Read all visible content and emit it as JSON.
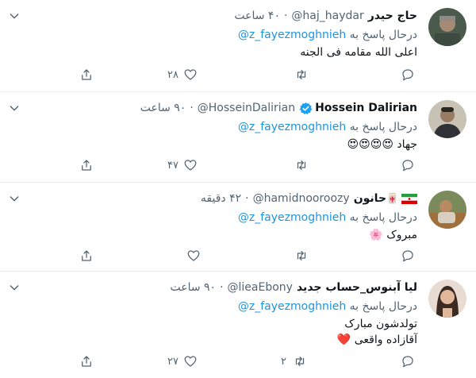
{
  "reply_prefix": "درحال پاسخ به",
  "colors": {
    "link": "#1b95e0",
    "muted": "#536471",
    "border": "#e6ecf0",
    "verified": "#1da1f2"
  },
  "tweets": [
    {
      "name": "حاج حیدر",
      "handle": "@haj_haydar",
      "time": "۴۰ ساعت",
      "reply_to": "@z_fayezmoghnieh",
      "text": "اعلی الله مقامه فی الجنه",
      "reply_count": "",
      "retweet_count": "",
      "like_count": "۲۸"
    },
    {
      "name": "Hossein Dalirian",
      "handle": "@HosseinDalirian",
      "time": "۹۰ ساعت",
      "verified": true,
      "reply_to": "@z_fayezmoghnieh",
      "text": "جهاد",
      "emoji": "😍😍😍😍",
      "reply_count": "",
      "retweet_count": "",
      "like_count": "۴۷"
    },
    {
      "name": "حانون",
      "name_icon": "🀄",
      "flag": "iran-flag",
      "handle": "@hamidnooroozy",
      "time": "۴۲ دقیقه",
      "reply_to": "@z_fayezmoghnieh",
      "text": "مبروک",
      "emoji": "🌸",
      "reply_count": "",
      "retweet_count": "",
      "like_count": ""
    },
    {
      "name": "لیا آبنوس_حساب جدید",
      "handle": "@lieaEbony",
      "time": "۹۰ ساعت",
      "reply_to": "@z_fayezmoghnieh",
      "text_lines": [
        "تولدشون مبارک",
        "آقازاده واقعی"
      ],
      "emoji": "❤️",
      "reply_count": "",
      "retweet_count": "۲",
      "like_count": "۲۷"
    }
  ]
}
